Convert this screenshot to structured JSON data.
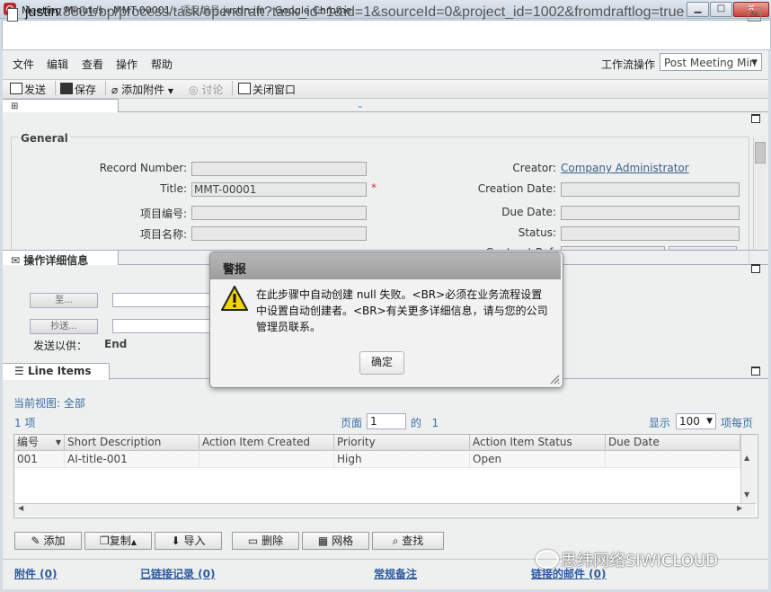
{
  "window": {
    "title_main": "Meeting Minutes - MMT-00001 - ",
    "title_faded": "项目编号",
    "title_user": " justin.jin - Google Chrome",
    "min_label": "▁",
    "max_label": "□",
    "close_label": "✕"
  },
  "address": {
    "host": "justin",
    "rest": ":8801/bp/process/task/opendraft?task_id=1&id=1&sourceId=0&project_id=1002&fromdraftlog=true"
  },
  "menu": {
    "items": [
      "文件",
      "编辑",
      "查看",
      "操作",
      "帮助"
    ],
    "workflow_label": "工作流操作",
    "workflow_value": "Post Meeting Min"
  },
  "toolbar": {
    "send": "发送",
    "save": "保存",
    "attach": "添加附件",
    "discuss": "讨论",
    "close_window": "关闭窗口"
  },
  "general": {
    "legend": "General",
    "record_number_label": "Record Number:",
    "title_label": "Title:",
    "title_value": "MMT-00001",
    "required_mark": "*",
    "project_no_label": "项目编号:",
    "project_name_label": "项目名称:",
    "creator_label": "Creator:",
    "creator_value": "Company Administrator",
    "creation_date_label": "Creation Date:",
    "due_date_label": "Due Date:",
    "status_label": "Status:",
    "contract_label": "Contract Ref:"
  },
  "ops": {
    "title": "操作详细信息",
    "to_btn": "至...",
    "cc_btn": "抄送...",
    "send_to_label": "发送以供：",
    "send_to_value": "End"
  },
  "line_items": {
    "title": "Line Items",
    "current_view_label": "当前视图:",
    "current_view_value": "全部",
    "count_num": "1",
    "count_unit": "项",
    "page_label": "页面",
    "page_value": "1",
    "of_label": "的",
    "of_total": "1",
    "display_label": "显示",
    "per_page": "100",
    "per_page_label": "项每页",
    "columns": [
      "编号",
      "Short Description",
      "Action Item Created",
      "Priority",
      "Action Item Status",
      "Due Date"
    ],
    "rows": [
      [
        "001",
        "AI-title-001",
        "",
        "High",
        "Open",
        ""
      ]
    ],
    "buttons": {
      "add": "添加",
      "copy": "复制",
      "import": "导入",
      "delete": "删除",
      "grid": "网格",
      "find": "查找"
    }
  },
  "footer": {
    "attachments": "附件 (0)",
    "linked_records": "已链接记录 (0)",
    "notes": "常规备注",
    "linked_mail": "链接的邮件 (0)"
  },
  "watermark": "思纬网络SIWICLOUD",
  "dialog": {
    "title": "警报",
    "message": "在此步骤中自动创建 null 失败。<BR>必须在业务流程设置中设置自动创建者。<BR>有关更多详细信息，请与您的公司管理员联系。",
    "ok": "确定"
  }
}
